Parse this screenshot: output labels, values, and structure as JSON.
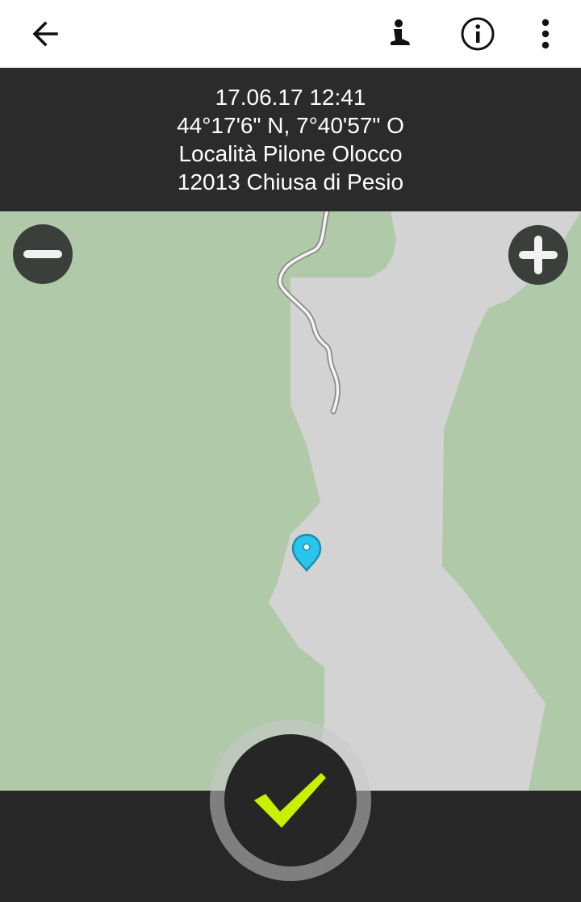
{
  "toolbar": {
    "back_icon": "arrow-back-icon",
    "person_icon": "hiker-icon",
    "info_icon": "info-icon",
    "menu_icon": "more-vert-icon"
  },
  "location_info": {
    "datetime": "17.06.17 12:41",
    "coordinates": "44°17'6\" N, 7°40'57\" O",
    "locality": "Località Pilone Olocco",
    "postal_city": "12013 Chiusa di Pesio"
  },
  "map": {
    "zoom_out_icon": "minus-icon",
    "zoom_in_icon": "plus-icon",
    "marker_icon": "location-pin-icon",
    "colors": {
      "forest": "#b0c9a8",
      "clearing": "#d3d3d3",
      "marker": "#29c6ec",
      "confirm_check": "#c8f000"
    }
  },
  "actions": {
    "confirm_icon": "check-icon"
  }
}
